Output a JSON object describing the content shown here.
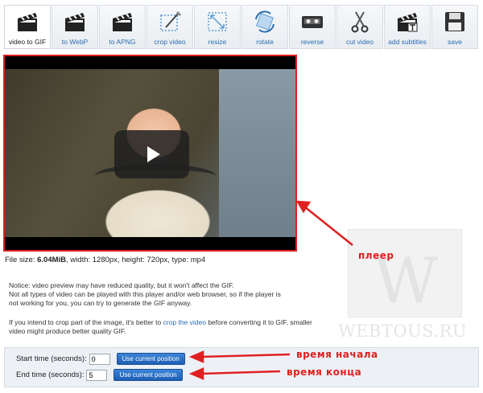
{
  "toolbar": {
    "items": [
      {
        "label": "video to GIF",
        "icon": "clapperboard-icon",
        "active": true
      },
      {
        "label": "to WebP",
        "icon": "clapperboard-icon"
      },
      {
        "label": "to APNG",
        "icon": "clapperboard-icon"
      },
      {
        "label": "crop video",
        "icon": "crop-icon"
      },
      {
        "label": "resize",
        "icon": "resize-icon"
      },
      {
        "label": "rotate",
        "icon": "rotate-icon"
      },
      {
        "label": "reverse",
        "icon": "cassette-icon"
      },
      {
        "label": "cut video",
        "icon": "scissors-icon"
      },
      {
        "label": "add subtitles",
        "icon": "subtitles-icon"
      },
      {
        "label": "save",
        "icon": "floppy-disk-icon"
      }
    ]
  },
  "player": {
    "play_icon": "play-icon"
  },
  "fileinfo": {
    "size_label": "File size:",
    "size_value": "6.04MiB",
    "rest": ", width: 1280px, height: 720px, type: mp4"
  },
  "notice": {
    "line1": "Notice: video preview may have reduced quality, but it won't affect the GIF.",
    "line2": "Not all types of video can be played with this player and/or web browser, so if the player is",
    "line3": "not working for you, you can try to generate the GIF anyway."
  },
  "hint": {
    "before": "If you intend to crop part of the image, it's better to ",
    "link": "crop the video",
    "after": " before converting it to GIF, smaller video might produce better quality GIF."
  },
  "time": {
    "start_label": "Start time (seconds):",
    "start_value": "0",
    "end_label": "End time (seconds):",
    "end_value": "5",
    "use_button": "Use current position"
  },
  "annotations": {
    "player": "плеер",
    "start": "время начала",
    "end": "время конца"
  },
  "watermark": {
    "letter": "W",
    "text": "WEBTOUS.RU"
  },
  "colors": {
    "annotation_red": "#e02020",
    "link_blue": "#2b6cb0",
    "button_blue": "#1d5fb4"
  }
}
